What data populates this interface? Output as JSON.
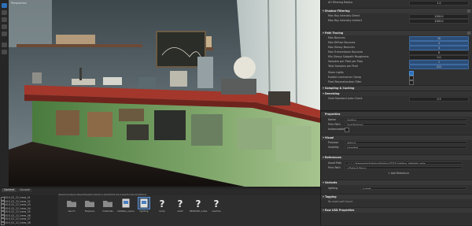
{
  "colors": {
    "accent": "#2e6fb8",
    "panel": "#303030",
    "field": "#222222"
  },
  "toolbar": {
    "tools": [
      "select-icon",
      "move-icon",
      "rotate-icon",
      "scale-icon",
      "snap-icon",
      "camera-icon",
      "light-icon"
    ]
  },
  "viewport": {
    "topleft_label": "Perspective"
  },
  "bottom": {
    "tabs": [
      "Content",
      "Console"
    ],
    "path": "depot/renderer/desert/tests/collection-test/2019-02-trees/furniture/lighting",
    "tree": [
      "2019_02_22_trees_01",
      "2019_02_22_trees_02",
      "2019_02_22_trees_03",
      "2019_02_22_trees_04",
      "2019_02_22_trees_05",
      "2019_02_22_trees_06",
      "2019_02_22_trees_07",
      "2019_02_22_trees_08"
    ],
    "files": [
      {
        "name": "bench",
        "icon": "folder-icon"
      },
      {
        "name": "fireplace",
        "icon": "folder-icon"
      },
      {
        "name": "materials",
        "icon": "folder-icon"
      },
      {
        "name": "labtable_scene",
        "icon": "scene-icon"
      },
      {
        "name": "lighting",
        "icon": "scene-icon",
        "selected": true
      },
      {
        "name": "lamp",
        "icon": "unknown-icon"
      },
      {
        "name": "shelf",
        "icon": "unknown-icon"
      },
      {
        "name": "RELEASE_notes",
        "icon": "unknown-icon"
      },
      {
        "name": "readme",
        "icon": "unknown-icon"
      }
    ]
  },
  "panel": {
    "top_rows": [
      {
        "label": "AO Filtering Radius",
        "value": "1.0"
      }
    ],
    "sections": [
      {
        "title": "Shadow Filtering",
        "rows": [
          {
            "label": "Max Ray Intensity Direct",
            "value": "1000.0"
          },
          {
            "label": "Max Ray Intensity Indirect",
            "value": "1000.0"
          }
        ]
      },
      {
        "title": "Path Tracing",
        "rows": [
          {
            "label": "Max Bounces",
            "value": "10"
          },
          {
            "label": "Max Diffuse Bounces",
            "value": "4"
          },
          {
            "label": "Max Glossy Bounces",
            "value": "4"
          },
          {
            "label": "Max Transmission Bounces",
            "value": "8"
          },
          {
            "label": "Min Glossy Subpath Roughness",
            "value": "0.0"
          },
          {
            "label": "Samples per Pixel per Pass",
            "value": "1"
          },
          {
            "label": "Total Samples per Pixel",
            "value": "512"
          }
        ]
      }
    ],
    "checks": [
      {
        "label": "Show Lights",
        "on": true
      },
      {
        "label": "Enable Luminance Clamp",
        "on": false
      },
      {
        "label": "Pixel Reconstruction Filter",
        "on": false
      }
    ],
    "section2": {
      "title": "Sampling & Caching",
      "sub": "Denoising",
      "rows": [
        {
          "label": "Gold Standard Auto Check",
          "value": "0.3"
        }
      ]
    },
    "properties": {
      "title": "Properties",
      "name_label": "Name",
      "name_value": "lighting",
      "rows": [
        {
          "label": "Prim Path",
          "value": "/root/lighting"
        },
        {
          "label": "Instanceable",
          "value": ""
        }
      ]
    },
    "visual": {
      "title": "Visual",
      "rows": [
        {
          "label": "Purpose",
          "value": "default"
        },
        {
          "label": "Visibility",
          "value": "inherited"
        }
      ]
    },
    "refs": {
      "title": "References",
      "asset_label": "Asset Path",
      "asset_value": "../../../_fragments/lighting/lighting/2019_lighting_labtable.usda",
      "prim_label": "Prim Path",
      "prim_value": "<Default Prim>",
      "add_label": "Add Reference"
    },
    "variants": {
      "title": "Variants",
      "rows": [
        {
          "label": "lighting",
          "value": "sunset"
        }
      ]
    },
    "tagging": {
      "title": "Tagging",
      "note": "No asset path found"
    },
    "raw": {
      "title": "Raw USD Properties"
    }
  }
}
